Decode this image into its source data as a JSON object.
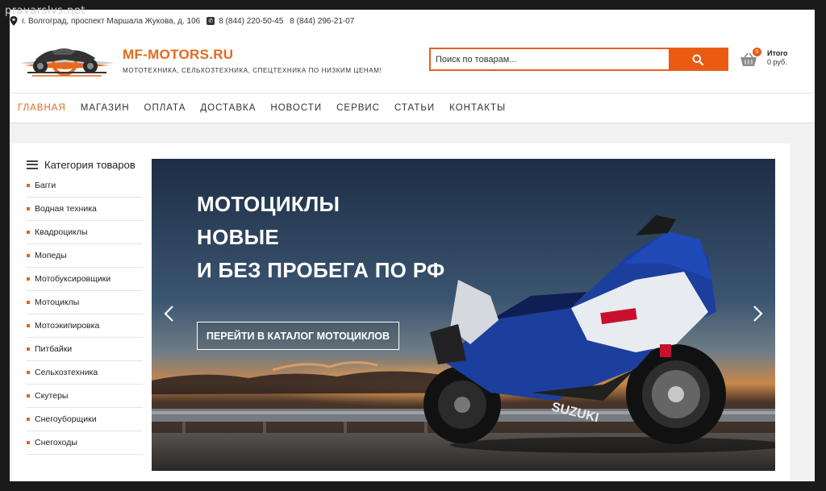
{
  "watermark": "pravarslvs.net",
  "topbar": {
    "address": "г. Волгоград, проспект Маршала Жукова, д. 106",
    "phone1": "8 (844) 220-50-45",
    "phone2": "8 (844) 296-21-07"
  },
  "brand": {
    "name": "MF-MOTORS.RU",
    "tagline": "МОТОТЕХНИКА, СЕЛЬХОЗТЕХНИКА, СПЕЦТЕХНИКА ПО НИЗКИМ ЦЕНАМ!"
  },
  "search": {
    "placeholder": "Поиск по товарам..."
  },
  "cart": {
    "count": "0",
    "label": "Итого",
    "sum": "0 руб."
  },
  "nav": {
    "items": [
      "ГЛАВНАЯ",
      "МАГАЗИН",
      "ОПЛАТА",
      "ДОСТАВКА",
      "НОВОСТИ",
      "СЕРВИС",
      "СТАТЬИ",
      "КОНТАКТЫ"
    ],
    "active": "ГЛАВНАЯ"
  },
  "catalog": {
    "title": "Категория товаров",
    "items": [
      "Багги",
      "Водная техника",
      "Квадроциклы",
      "Мопеды",
      "Мотобуксировщики",
      "Мотоциклы",
      "Мотоэкипировка",
      "Питбайки",
      "Сельхозтехника",
      "Скутеры",
      "Снегоуборщики",
      "Снегоходы"
    ]
  },
  "slider": {
    "line1": "МОТОЦИКЛЫ",
    "line2": "НОВЫЕ",
    "line3": "И БЕЗ ПРОБЕГА ПО РФ",
    "button": "ПЕРЕЙТИ В КАТАЛОГ МОТОЦИКЛОВ",
    "bike_brand": "SUZUKI"
  },
  "colors": {
    "accent": "#e8611a",
    "brand": "#e36b1f",
    "bike_blue": "#1c3f9e"
  }
}
